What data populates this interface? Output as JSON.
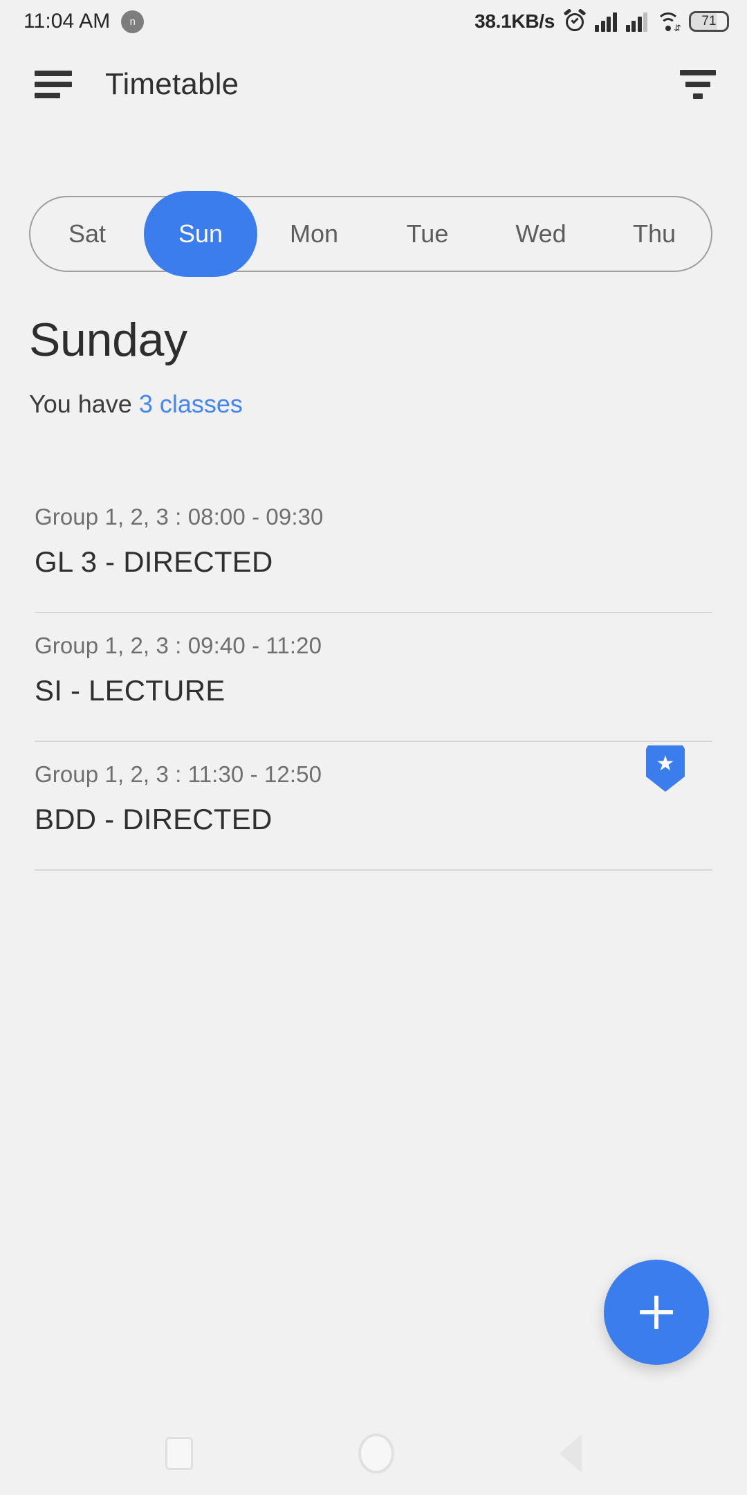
{
  "status_bar": {
    "time": "11:04 AM",
    "notification_badge": "n",
    "network_speed": "38.1KB/s",
    "battery_level": "71",
    "icons": [
      "alarm-icon",
      "signal-icon",
      "signal-icon",
      "wifi-icon",
      "battery-icon"
    ]
  },
  "app_bar": {
    "menu_icon": "hamburger-menu-icon",
    "title": "Timetable",
    "filter_icon": "filter-icon"
  },
  "day_selector": {
    "days": [
      {
        "label": "Sat",
        "active": false
      },
      {
        "label": "Sun",
        "active": true
      },
      {
        "label": "Mon",
        "active": false
      },
      {
        "label": "Tue",
        "active": false
      },
      {
        "label": "Wed",
        "active": false
      },
      {
        "label": "Thu",
        "active": false
      }
    ],
    "active_color": "#3b7ded"
  },
  "header": {
    "day_title": "Sunday",
    "subtitle_prefix": "You have ",
    "subtitle_count": "3 classes",
    "count_color": "#4285f4"
  },
  "classes": [
    {
      "meta": "Group 1, 2, 3  :  08:00 - 09:30",
      "name": "GL 3 - DIRECTED",
      "starred": false
    },
    {
      "meta": "Group 1, 2, 3  :  09:40 - 11:20",
      "name": "SI - LECTURE",
      "starred": false
    },
    {
      "meta": "Group 1, 2, 3  :  11:30 - 12:50",
      "name": "BDD - DIRECTED",
      "starred": true,
      "star_glyph": "★"
    }
  ],
  "fab": {
    "icon": "plus-icon",
    "color": "#3b7ded"
  },
  "nav_bar": {
    "recents": "recents-square-icon",
    "home": "home-circle-icon",
    "back": "back-triangle-icon"
  }
}
